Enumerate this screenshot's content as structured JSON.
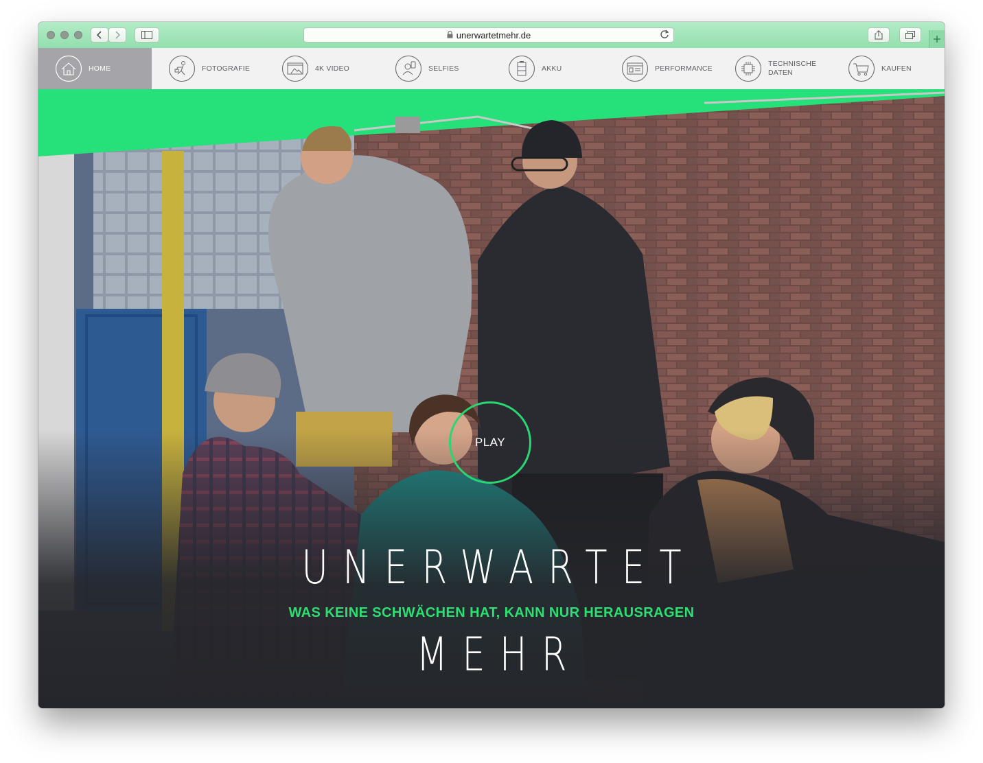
{
  "browser": {
    "url": "unerwartetmehr.de",
    "titlebar_color": "#9fe4b7"
  },
  "nav": {
    "items": [
      {
        "label": "HOME",
        "icon": "house-icon",
        "active": true
      },
      {
        "label": "FOTOGRAFIE",
        "icon": "camera-person-icon"
      },
      {
        "label": "4K VIDEO",
        "icon": "video-icon"
      },
      {
        "label": "SELFIES",
        "icon": "selfie-icon"
      },
      {
        "label": "AKKU",
        "icon": "battery-icon"
      },
      {
        "label": "PERFORMANCE",
        "icon": "performance-icon"
      },
      {
        "label": "TECHNISCHE DATEN",
        "icon": "chip-icon"
      },
      {
        "label": "KAUFEN",
        "icon": "cart-icon"
      }
    ]
  },
  "hero": {
    "play_label": "PLAY",
    "headline_top": "UNERWARTET",
    "tagline": "WAS KEINE SCHWÄCHEN HAT, KANN NUR HERAUSRAGEN",
    "headline_bottom": "MEHR",
    "accent_color": "#26e07a"
  }
}
